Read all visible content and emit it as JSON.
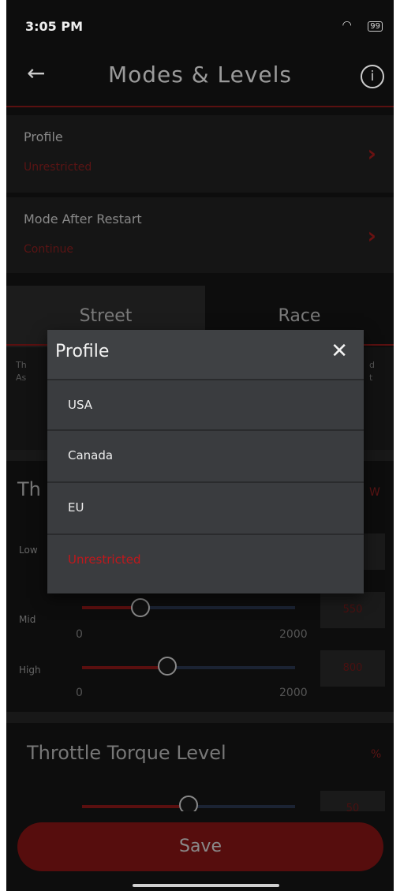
{
  "status_bar": {
    "time": "3:05 PM",
    "battery": "99"
  },
  "header": {
    "title": "Modes & Levels"
  },
  "settings": [
    {
      "label": "Profile",
      "value": "Unrestricted"
    },
    {
      "label": "Mode After Restart",
      "value": "Continue"
    }
  ],
  "tabs": [
    "Street",
    "Race"
  ],
  "background_text": {
    "desc_left_1": "Th",
    "desc_left_2": "As",
    "desc_right_1": "d",
    "desc_right_2": "t",
    "section1_partial": "Th",
    "section1_unit": "W",
    "section2_title": "Throttle Torque Level",
    "section2_unit": "%"
  },
  "levels": [
    {
      "label": "Low"
    },
    {
      "label": "Mid",
      "min": "0",
      "max": "2000",
      "value": "550",
      "fraction": 0.275
    },
    {
      "label": "High",
      "min": "0",
      "max": "2000",
      "value": "800",
      "fraction": 0.4
    }
  ],
  "torque_level": {
    "value": "50",
    "fraction": 0.5
  },
  "save_label": "Save",
  "modal": {
    "title": "Profile",
    "options": [
      "USA",
      "Canada",
      "EU",
      "Unrestricted"
    ],
    "selected": "Unrestricted"
  },
  "colors": {
    "accent": "#c0181c",
    "dim_accent": "#560d0d"
  }
}
